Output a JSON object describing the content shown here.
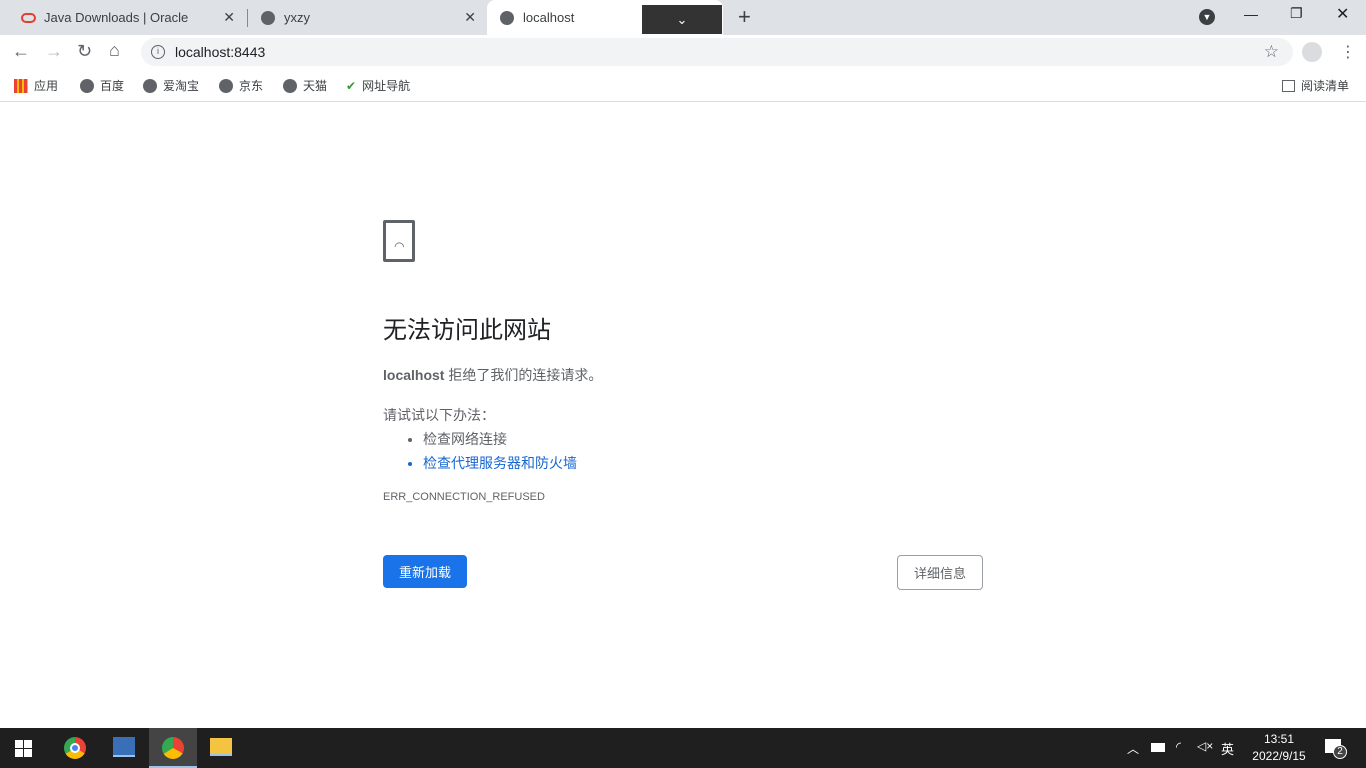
{
  "tabs": [
    {
      "title": "Java Downloads | Oracle"
    },
    {
      "title": "yxzy"
    },
    {
      "title": "localhost"
    }
  ],
  "address": {
    "url": "localhost:8443"
  },
  "bookmarks": [
    {
      "label": "应用"
    },
    {
      "label": "百度"
    },
    {
      "label": "爱淘宝"
    },
    {
      "label": "京东"
    },
    {
      "label": "天猫"
    },
    {
      "label": "网址导航"
    }
  ],
  "reading_list": "阅读清单",
  "error": {
    "title": "无法访问此网站",
    "host": "localhost",
    "message": " 拒绝了我们的连接请求。",
    "try_label": "请试试以下办法：",
    "suggestions": [
      "检查网络连接",
      "检查代理服务器和防火墙"
    ],
    "code": "ERR_CONNECTION_REFUSED",
    "reload": "重新加载",
    "details": "详细信息"
  },
  "taskbar": {
    "time": "13:51",
    "date": "2022/9/15",
    "ime": "英",
    "notifications": "2"
  },
  "colors": {
    "accent": "#1a73e8",
    "link": "#1967d2"
  }
}
